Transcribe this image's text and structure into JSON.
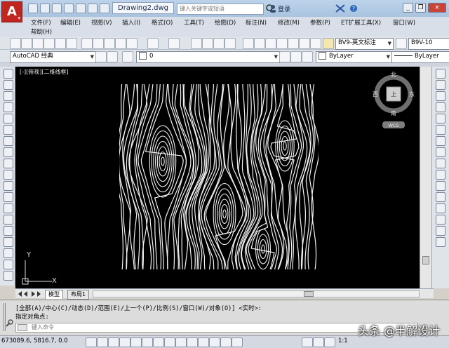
{
  "titlebar": {
    "doc_title": "Drawing2.dwg",
    "search_placeholder": "键入关键字或短语",
    "login_label": "登录",
    "help_label": "?",
    "minimize": "_",
    "restore": "❐",
    "close": "×"
  },
  "menu": [
    "文件(F)",
    "编辑(E)",
    "视图(V)",
    "插入(I)",
    "格式(O)",
    "工具(T)",
    "绘图(D)",
    "标注(N)",
    "修改(M)",
    "参数(P)",
    "ET扩展工具(X)",
    "窗口(W)",
    "帮助(H)"
  ],
  "toolbars": {
    "dim_style": "BV9-英文标注",
    "text_style": "B9V-10",
    "workspace": "AutoCAD 经典",
    "layer": "0",
    "color": "ByLayer",
    "linetype": "ByLayer"
  },
  "viewport": {
    "label": "[-][俯视][二维线框]",
    "viewcube": {
      "north": "北",
      "south": "南",
      "east": "东",
      "west": "西",
      "top": "上",
      "ucs": "WCS"
    },
    "ucs_x": "X",
    "ucs_y": "Y"
  },
  "tabs": [
    "模型",
    "布局1"
  ],
  "command": {
    "history1": "[全部(A)/中心(C)/动态(D)/范围(E)/上一个(P)/比例(S)/窗口(W)/对象(O)] <实时>:",
    "history2": "指定对角点:",
    "placeholder": "键入命令"
  },
  "status": {
    "coords": "673089.6, 5816.7, 0.0",
    "scale": "1:1"
  },
  "watermark": "头条 @半解设计"
}
